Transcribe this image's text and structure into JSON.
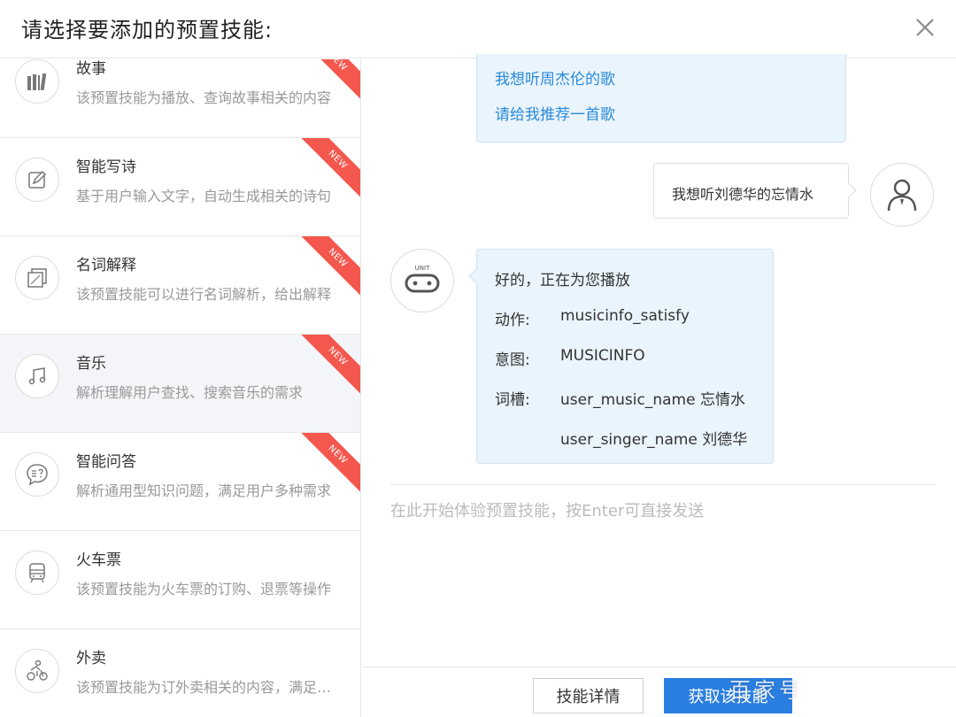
{
  "header": {
    "title": "请选择要添加的预置技能:",
    "close_icon": "close-icon"
  },
  "skills": [
    {
      "name": "故事",
      "desc": "该预置技能为播放、查询故事相关的内容",
      "icon": "book-icon",
      "badge": "NEW"
    },
    {
      "name": "智能写诗",
      "desc": "基于用户输入文字，自动生成相关的诗句",
      "icon": "pen-icon",
      "badge": "NEW"
    },
    {
      "name": "名词解释",
      "desc": "该预置技能可以进行名词解析，给出解释",
      "icon": "dictionary-icon",
      "badge": "NEW"
    },
    {
      "name": "音乐",
      "desc": "解析理解用户查找、搜索音乐的需求",
      "icon": "music-note-icon",
      "badge": "NEW",
      "active": true
    },
    {
      "name": "智能问答",
      "desc": "解析通用型知识问题，满足用户多种需求",
      "icon": "chat-question-icon",
      "badge": "NEW"
    },
    {
      "name": "火车票",
      "desc": "该预置技能为火车票的订购、退票等操作",
      "icon": "train-icon",
      "badge": ""
    },
    {
      "name": "外卖",
      "desc": "该预置技能为订外卖相关的内容，满足用户",
      "icon": "delivery-bike-icon",
      "badge": ""
    }
  ],
  "chat": {
    "previous_suggestions": [
      "我想听周杰伦的歌",
      "请给我推荐一首歌"
    ],
    "user_message": "我想听刘德华的忘情水",
    "user_avatar_icon": "user-avatar-icon",
    "bot_avatar_icon": "unit-robot-icon",
    "bot_avatar_text": "UNIT",
    "bot_reply": {
      "greeting": "好的，正在为您播放",
      "action_label": "动作:",
      "action_value": "musicinfo_satisfy",
      "intent_label": "意图:",
      "intent_value": "MUSICINFO",
      "slots_label": "词槽:",
      "slots": [
        "user_music_name 忘情水",
        "user_singer_name 刘德华"
      ]
    },
    "input_placeholder": "在此开始体验预置技能，按Enter可直接发送"
  },
  "footer": {
    "detail_button": "技能详情",
    "get_button": "获取该技能"
  },
  "watermark": "百家号",
  "colors": {
    "accent": "#2a7ee0",
    "link": "#2a8ad8",
    "badge": "#f4574d",
    "bubble": "#eaf4fc"
  }
}
